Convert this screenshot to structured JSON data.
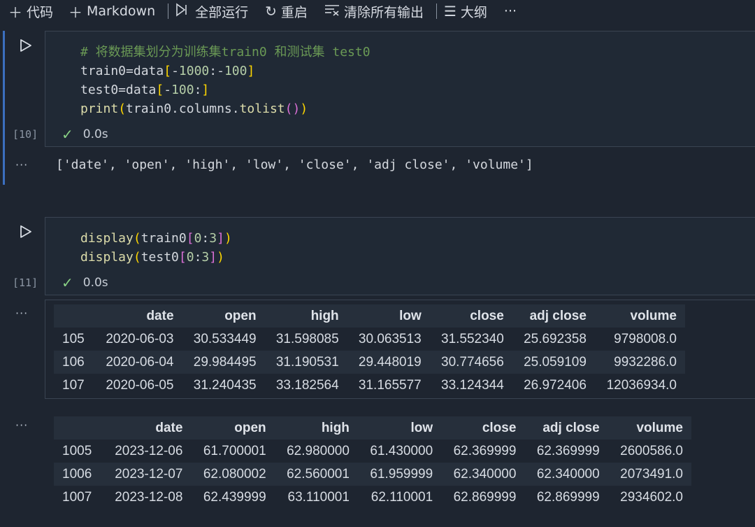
{
  "toolbar": {
    "code_label": "代码",
    "markdown_label": "Markdown",
    "run_all_label": "全部运行",
    "restart_label": "重启",
    "clear_outputs_label": "清除所有输出",
    "outline_label": "大纲",
    "more_label": "···"
  },
  "cell1": {
    "exec_count": "[10]",
    "status_time": "0.0s",
    "output": "['date', 'open', 'high', 'low', 'close', 'adj close', 'volume']"
  },
  "cell2": {
    "exec_count": "[11]",
    "status_time": "0.0s",
    "table1": {
      "columns": [
        "",
        "date",
        "open",
        "high",
        "low",
        "close",
        "adj close",
        "volume"
      ],
      "rows": [
        [
          "105",
          "2020-06-03",
          "30.533449",
          "31.598085",
          "30.063513",
          "31.552340",
          "25.692358",
          "9798008.0"
        ],
        [
          "106",
          "2020-06-04",
          "29.984495",
          "31.190531",
          "29.448019",
          "30.774656",
          "25.059109",
          "9932286.0"
        ],
        [
          "107",
          "2020-06-05",
          "31.240435",
          "33.182564",
          "31.165577",
          "33.124344",
          "26.972406",
          "12036934.0"
        ]
      ]
    },
    "table2": {
      "columns": [
        "",
        "date",
        "open",
        "high",
        "low",
        "close",
        "adj close",
        "volume"
      ],
      "rows": [
        [
          "1005",
          "2023-12-06",
          "61.700001",
          "62.980000",
          "61.430000",
          "62.369999",
          "62.369999",
          "2600586.0"
        ],
        [
          "1006",
          "2023-12-07",
          "62.080002",
          "62.560001",
          "61.959999",
          "62.340000",
          "62.340000",
          "2073491.0"
        ],
        [
          "1007",
          "2023-12-08",
          "62.439999",
          "63.110001",
          "62.110001",
          "62.869999",
          "62.869999",
          "2934602.0"
        ]
      ]
    }
  },
  "output_dots": "···"
}
